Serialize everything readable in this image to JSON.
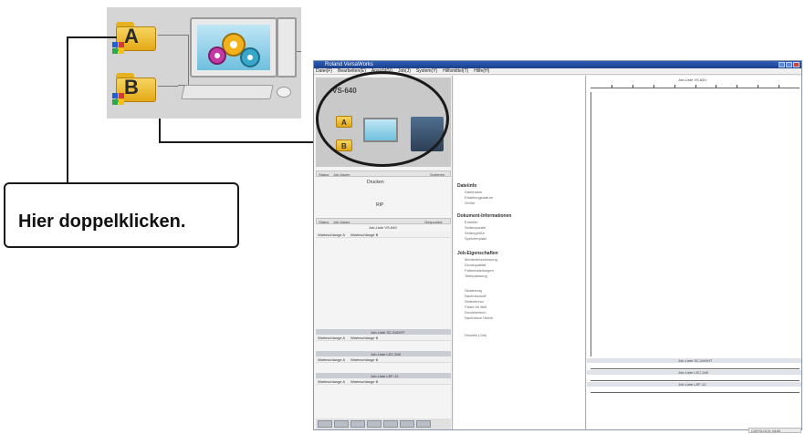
{
  "instruction": "Hier doppelklicken.",
  "callout": {
    "folder_a": "A",
    "folder_b": "B"
  },
  "window": {
    "title": "Roland VersaWorks",
    "menu": [
      "Datei(F)",
      "Bearbeiten(E)",
      "Ansicht(V)",
      "Job(J)",
      "System(Y)",
      "Hilfsmittel(T)",
      "Hilfe(H)"
    ]
  },
  "printer_panel": {
    "model": "VS-640",
    "mini_a": "A",
    "mini_b": "B"
  },
  "queue_a": {
    "header_status": "Status",
    "header_jobname": "Job-Name",
    "header_sorting": "Sortieren",
    "printing_label": "Drucken",
    "rip_label": "RIP"
  },
  "queue_b": {
    "header_status": "Status",
    "header_jobname": "Job-Name",
    "header_spooled": "Gespooled",
    "job_name": "Job-Liste VS-640",
    "tab_a": "Warteschlange A",
    "tab_b": "Warteschlange B"
  },
  "queue_jobs": [
    {
      "name": "Job-Liste SC-540/HT",
      "tab_a": "Warteschlange A",
      "tab_b": "Warteschlange B"
    },
    {
      "name": "Job-Liste LEC-540",
      "tab_a": "Warteschlange A",
      "tab_b": "Warteschlange B"
    },
    {
      "name": "Job-Liste LEF-12",
      "tab_a": "Warteschlange A",
      "tab_b": "Warteschlange B"
    }
  ],
  "properties": [
    {
      "heading": "Dateiinfo",
      "items": [
        "Dateiname",
        "Erstellungsdatum",
        "Größe"
      ]
    },
    {
      "heading": "Dokument-Informationen",
      "items": [
        "Ersteller",
        "Seitenanzahl",
        "Seitengröße",
        "Speicherplatz"
      ]
    },
    {
      "heading": "Job-Eigenschaften",
      "items": [
        "Medienbezeichnung",
        "Druckqualität",
        "Farbeinstellungen",
        "Teilerpassung",
        "",
        "Skalierung",
        "Nachdruckoff",
        "Seitenkreuz",
        "Farbe für Beit",
        "Druckbereich",
        "Nachdruck Überk.",
        "",
        "Hinweis (Job)"
      ]
    }
  ],
  "preview": {
    "top_label": "Job-Liste VS-640",
    "band_labels": [
      "Job-Liste SC-540/HT",
      "Job-Liste LEC-540",
      "Job-Liste LEF-12"
    ]
  },
  "status_bar": "CAPSLOCK NUM"
}
